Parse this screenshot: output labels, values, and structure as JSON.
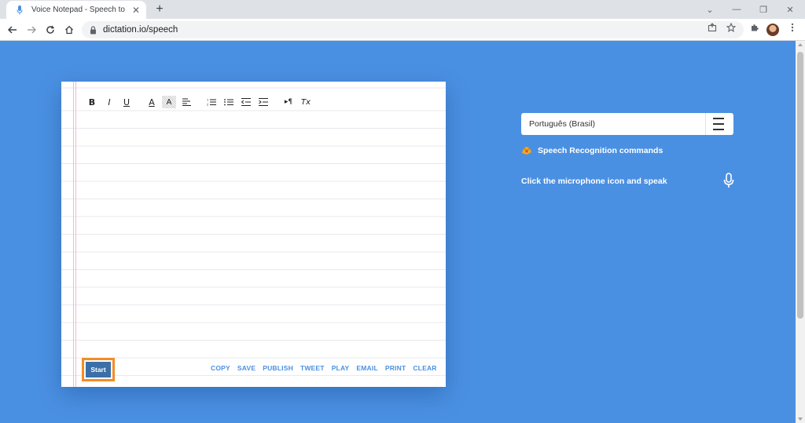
{
  "browser": {
    "tab_title": "Voice Notepad - Speech to Text",
    "url": "dictation.io/speech"
  },
  "editor": {
    "toolbar": [
      {
        "name": "bold",
        "glyph": "B"
      },
      {
        "name": "italic",
        "glyph": "I"
      },
      {
        "name": "underline",
        "glyph": "U"
      },
      {
        "name": "font-color",
        "glyph": "A"
      },
      {
        "name": "highlight",
        "glyph": "A"
      },
      {
        "name": "align",
        "glyph": "≡"
      },
      {
        "name": "numbered-list",
        "glyph": "1≡"
      },
      {
        "name": "bullet-list",
        "glyph": "•≡"
      },
      {
        "name": "outdent",
        "glyph": "⇤"
      },
      {
        "name": "indent",
        "glyph": "⇥"
      },
      {
        "name": "paragraph-direction",
        "glyph": "▸¶"
      },
      {
        "name": "clear-format",
        "glyph": "Tx"
      }
    ],
    "start_label": "Start",
    "actions": [
      "COPY",
      "SAVE",
      "PUBLISH",
      "TWEET",
      "PLAY",
      "EMAIL",
      "PRINT",
      "CLEAR"
    ]
  },
  "sidebar": {
    "language": "Português (Brasil)",
    "commands_label": "Speech Recognition commands",
    "hint": "Click the microphone icon and speak"
  },
  "colors": {
    "background": "#4a90e2",
    "start_button": "#3b6fa8",
    "highlight_border": "#f28c28",
    "action_link": "#4a90e2"
  }
}
